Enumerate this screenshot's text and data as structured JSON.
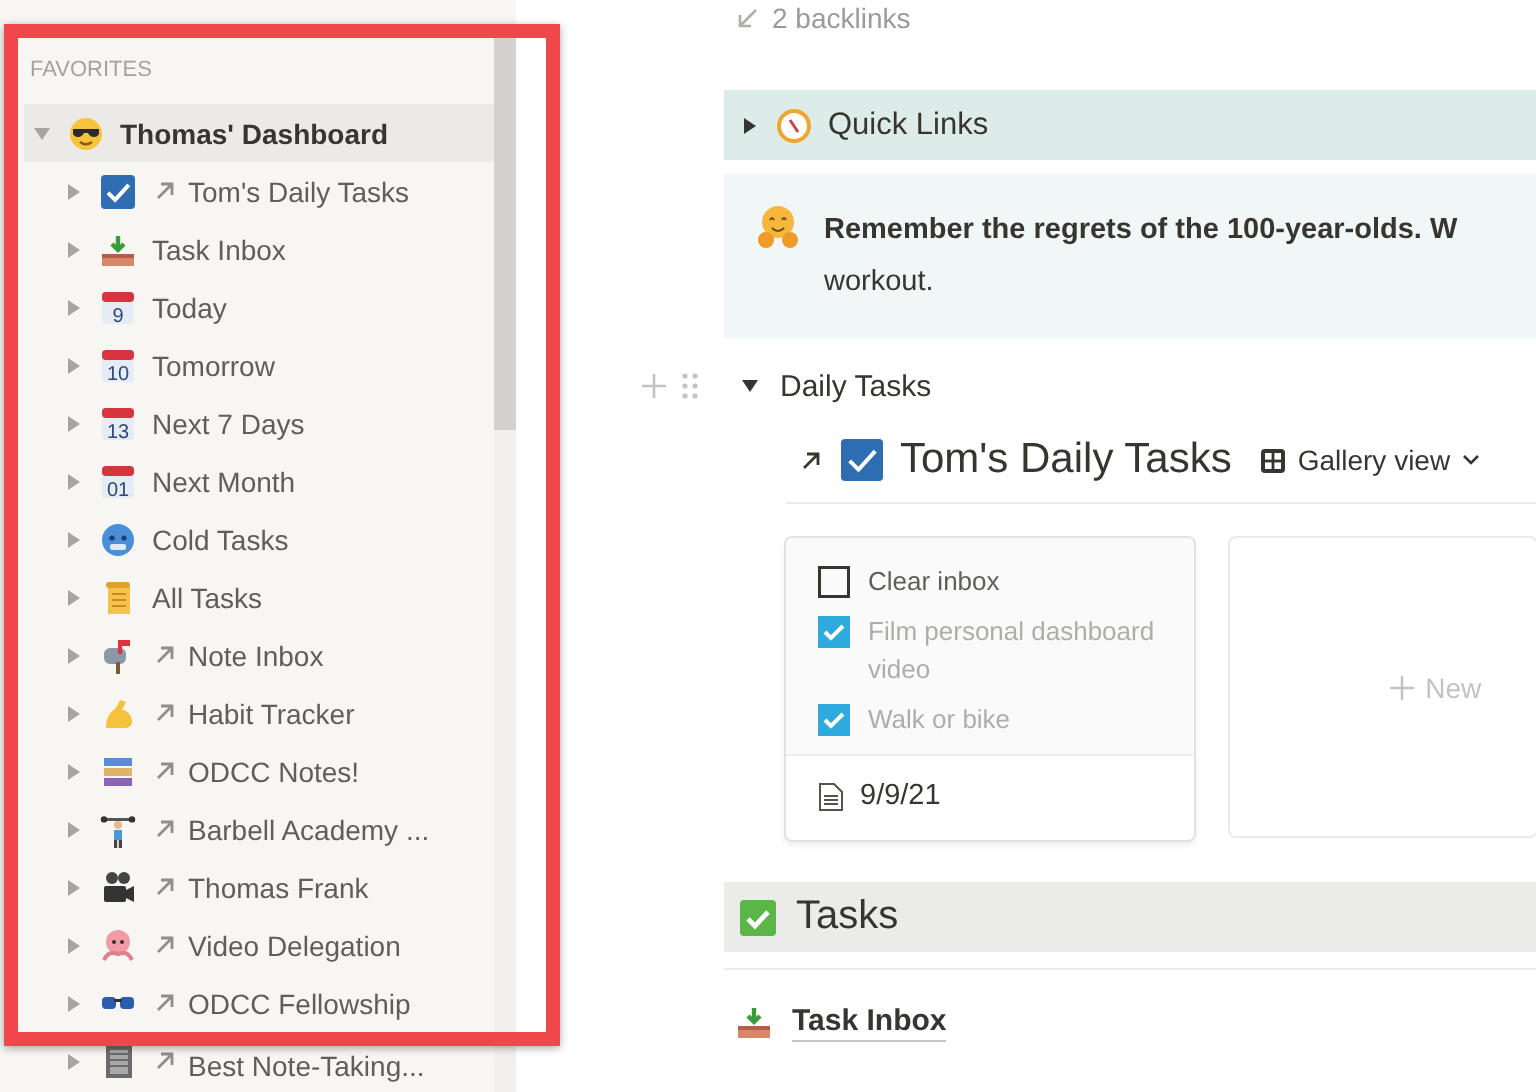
{
  "sidebar": {
    "section_label": "FAVORITES",
    "items": [
      {
        "label": "Thomas' Dashboard",
        "expanded": true,
        "selected": true,
        "children": [
          {
            "label": "Tom's Daily Tasks",
            "link": true,
            "expanded": false,
            "selected": false
          },
          {
            "label": "Task Inbox",
            "link": false,
            "expanded": false,
            "selected": false
          },
          {
            "label": "Today",
            "link": false,
            "expanded": false,
            "selected": false,
            "calendar_day": "9"
          },
          {
            "label": "Tomorrow",
            "link": false,
            "expanded": false,
            "selected": false,
            "calendar_day": "10"
          },
          {
            "label": "Next 7 Days",
            "link": false,
            "expanded": false,
            "selected": false,
            "calendar_day": "13"
          },
          {
            "label": "Next Month",
            "link": false,
            "expanded": false,
            "selected": false,
            "calendar_day": "01"
          },
          {
            "label": "Cold Tasks",
            "link": false,
            "expanded": false,
            "selected": false
          },
          {
            "label": "All Tasks",
            "link": false,
            "expanded": false,
            "selected": false
          },
          {
            "label": "Note Inbox",
            "link": true,
            "expanded": false,
            "selected": false
          },
          {
            "label": "Habit Tracker",
            "link": true,
            "expanded": false,
            "selected": false
          },
          {
            "label": "ODCC Notes!",
            "link": true,
            "expanded": false,
            "selected": false
          },
          {
            "label": "Barbell Academy ...",
            "link": true,
            "expanded": false,
            "selected": false
          },
          {
            "label": "Thomas Frank",
            "link": true,
            "expanded": false,
            "selected": false
          },
          {
            "label": "Video Delegation",
            "link": true,
            "expanded": false,
            "selected": false
          },
          {
            "label": "ODCC Fellowship",
            "link": true,
            "expanded": false,
            "selected": false
          },
          {
            "label": "Best Note-Taking...",
            "link": true,
            "expanded": false,
            "selected": false
          }
        ]
      }
    ]
  },
  "page": {
    "backlinks": "2 backlinks",
    "quick_links": {
      "label": "Quick Links",
      "expanded": false
    },
    "callout": {
      "lines": [
        {
          "text": "Remember the regrets of the 100-year-olds. W",
          "bold": true
        },
        {
          "text": "workout.",
          "bold": false
        }
      ]
    },
    "daily_tasks": {
      "label": "Daily Tasks",
      "expanded": true,
      "database": {
        "title": "Tom's Daily Tasks",
        "link": true,
        "view": "Gallery view",
        "cards": [
          {
            "todos": [
              {
                "text": "Clear inbox",
                "checked": false
              },
              {
                "text": "Film personal dashboard video",
                "checked": true
              },
              {
                "text": "Walk or bike",
                "checked": true
              }
            ],
            "date": "9/9/21"
          }
        ],
        "new_label": "New"
      }
    },
    "tasks_heading": "Tasks",
    "task_links": [
      "Task Inbox"
    ]
  }
}
